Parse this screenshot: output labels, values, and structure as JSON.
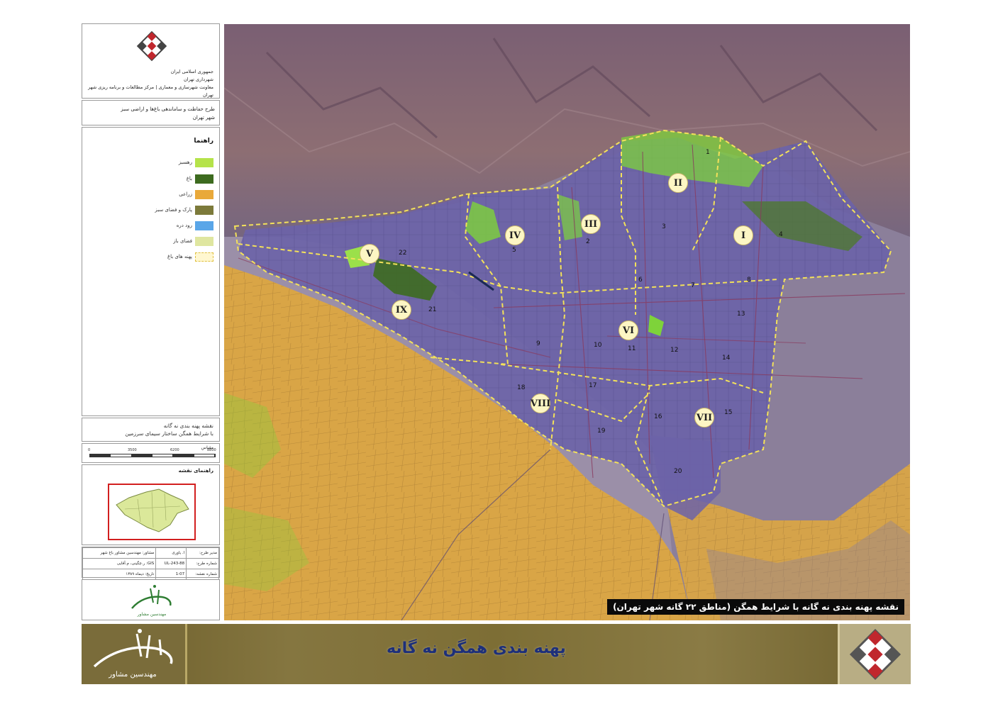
{
  "header": {
    "lines": [
      "جمهوری اسلامی ایران",
      "شهرداری تهران",
      "معاونت شهرسازی و معماری | مرکز مطالعات و برنامه ریزی شهر تهران"
    ]
  },
  "project_title": {
    "line1": "طرح حفاظت و ساماندهی باغ‌ها و اراضی سبز",
    "line2": "شهر تهران"
  },
  "legend": {
    "title": "راهنما",
    "items": [
      {
        "label": "رهسبز",
        "color": "#b5e34a"
      },
      {
        "label": "باغ",
        "color": "#3d6b1f"
      },
      {
        "label": "زراعی",
        "color": "#e9a93a"
      },
      {
        "label": "پارک و فضای سبز",
        "color": "#7c7a3a"
      },
      {
        "label": "رود دره",
        "color": "#5aa6e8"
      },
      {
        "label": "فضای باز",
        "color": "#dfe6a0"
      },
      {
        "label": "پهنه های باغ",
        "color": "#fff7d0"
      }
    ]
  },
  "map_title": {
    "line1": "نقشه پهنه بندی نه گانه",
    "line2": "با شرایط همگن ساختار سیمای سرزمین"
  },
  "scale": {
    "title": "مقیاس",
    "ticks": [
      "0",
      "3500",
      "6200",
      "8800"
    ]
  },
  "index_map": {
    "title": "راهنمای نقشه"
  },
  "meta": {
    "rows": [
      [
        "مدیر طرح:",
        "ا. یاوری",
        "مشاور: مهندسین مشاور باغ شهر"
      ],
      [
        "شماره طرح:",
        "243-88-UL",
        "GIS: ر.چگینی، م.آقایی"
      ],
      [
        "شماره نقشه:",
        "1-07",
        "تاریخ: دیماه ۱۳۸۹"
      ]
    ]
  },
  "logo": {
    "text": "باغ شهر",
    "subtext": "مهندسین مشاور"
  },
  "map": {
    "caption": "نقشه پهنه بندی نه گانه با شرایط همگن (مناطق ۲۲ گانه شهر تهران)",
    "zones": [
      "I",
      "II",
      "III",
      "IV",
      "V",
      "VI",
      "VII",
      "VIII",
      "IX"
    ],
    "districts": [
      "1",
      "2",
      "3",
      "4",
      "5",
      "6",
      "7",
      "8",
      "9",
      "10",
      "11",
      "12",
      "13",
      "14",
      "15",
      "16",
      "17",
      "18",
      "19",
      "20",
      "21",
      "22"
    ]
  },
  "banner": {
    "title": "پهنه بندی همگن نه گانه"
  },
  "colors": {
    "urban": "#6c63a8",
    "mountain": "#8a6a7a",
    "agriculture": "#d9a546",
    "vegetation": "#7ed33a",
    "boundary": "#f3e15a",
    "banner_text": "#1d2f7a",
    "index_frame": "#d21f1f"
  }
}
